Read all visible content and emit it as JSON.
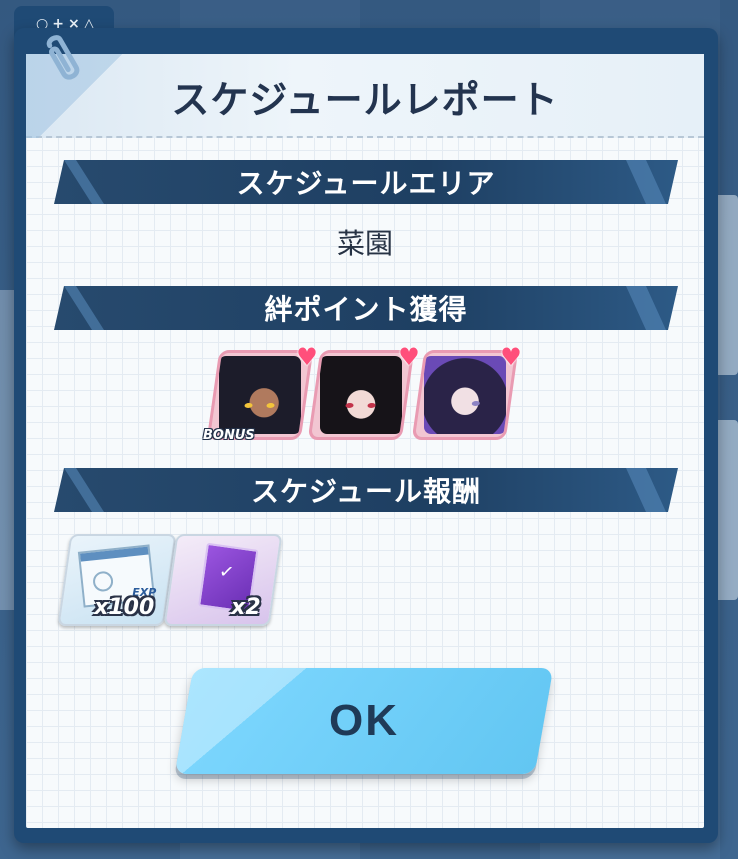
{
  "window": {
    "tab_glyphs": "○+×△"
  },
  "dialog": {
    "title": "スケジュールレポート"
  },
  "sections": {
    "area_header": "スケジュールエリア",
    "area_name": "菜園",
    "bond_header": "絆ポイント獲得",
    "reward_header": "スケジュール報酬"
  },
  "characters": [
    {
      "bonus_label": "BONUS",
      "heart_icon": "heart-icon",
      "eye_color": "#f3c53b"
    },
    {
      "bonus_label": "",
      "heart_icon": "heart-icon",
      "eye_color": "#c2334a"
    },
    {
      "bonus_label": "",
      "heart_icon": "heart-icon",
      "eye_color": "#8c82c4"
    }
  ],
  "rewards": [
    {
      "icon": "exp-report-icon",
      "tag": "EXP",
      "quantity": "x100"
    },
    {
      "icon": "ticket-icon",
      "tag": "",
      "quantity": "x2"
    }
  ],
  "buttons": {
    "ok_label": "OK"
  },
  "colors": {
    "banner": "#274a6e",
    "ok_button": "#7fd8ff",
    "heart": "#ff4f7b",
    "frame": "#1f4a75"
  }
}
